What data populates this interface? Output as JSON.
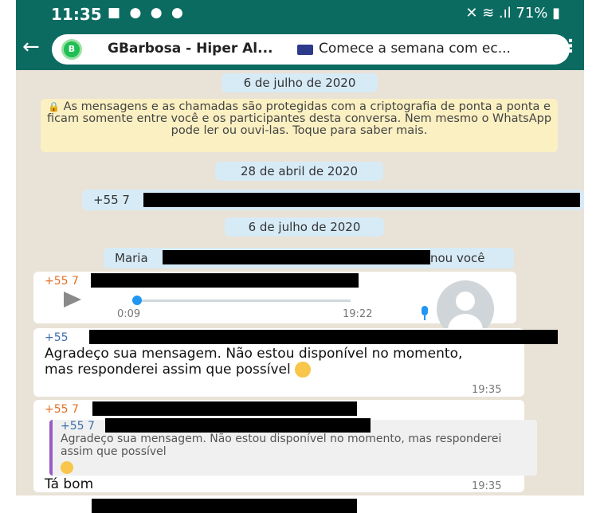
{
  "statusbar": {
    "time": "11:35",
    "notif_icons": "■ ● ● ●",
    "right_indicators": "✕ ≋ .ıl 71% ▮"
  },
  "header": {
    "back_icon": "arrow-left-icon",
    "contact_name": "GBarbosa - Hiper Al...",
    "status_text": "Comece a semana com ec...",
    "menu_icon": "more-vert-icon",
    "logo_letter": "B"
  },
  "conversation": {
    "date1": "6 de julho de 2020",
    "encryption_notice": "As mensagens e as chamadas são protegidas com a criptografia de ponta a ponta e ficam somente entre você e os participantes desta conversa. Nem mesmo o WhatsApp pode ler ou ouvi-las. Toque para saber mais.",
    "date2": "28 de abril de 2020",
    "system_msg1_prefix": "+55 7",
    "date3": "6 de julho de 2020",
    "system_msg2_prefix": "Maria",
    "system_msg2_suffix": "nou você",
    "audio": {
      "sender": "+55 7",
      "duration": "0:09",
      "time": "19:22"
    },
    "msg1": {
      "sender": "+55",
      "text": "Agradeço sua mensagem. Não estou disponível no momento, mas responderei assim que possível",
      "time": "19:35"
    },
    "msg2": {
      "sender": "+55 7",
      "quote_sender": "+55 7",
      "quote_text": "Agradeço sua mensagem. Não estou disponível no momento, mas responderei assim que possível",
      "text": "Tá bom",
      "time": "19:35"
    }
  },
  "colors": {
    "header": "#0b6b61",
    "chat_background": "#e9e2d6",
    "sender_orange": "#e56e26",
    "sender_blue": "#3b6ea8",
    "quote_bar": "#9b5bc6"
  }
}
